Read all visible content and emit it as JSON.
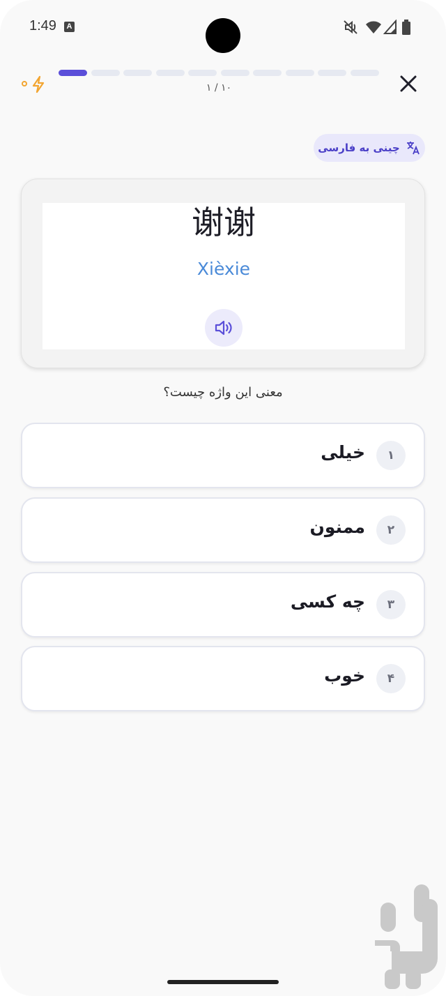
{
  "status_bar": {
    "time": "1:49",
    "keyboard_badge": "A",
    "icons": [
      "mute-icon",
      "wifi-icon",
      "signal-icon",
      "battery-icon"
    ]
  },
  "header": {
    "streak_icon": "bolt-icon",
    "progress": {
      "current": 1,
      "total": 10
    },
    "progress_label": "۱ / ۱۰",
    "close_icon": "close-icon"
  },
  "language_pill": {
    "label": "چینی به فارسی",
    "icon": "translate-icon"
  },
  "word_card": {
    "hanzi": "谢谢",
    "pinyin": "Xièxie",
    "speaker_icon": "speaker-icon"
  },
  "question": "معنی این واژه چیست؟",
  "options": [
    {
      "number": "۱",
      "label": "خیلی"
    },
    {
      "number": "۲",
      "label": "ممنون"
    },
    {
      "number": "۳",
      "label": "چه کسی"
    },
    {
      "number": "۴",
      "label": "خوب"
    }
  ],
  "colors": {
    "accent": "#5b4fd9",
    "pinyin": "#4a8ad8",
    "streak": "#f2a531",
    "background": "#f9f9f9"
  }
}
